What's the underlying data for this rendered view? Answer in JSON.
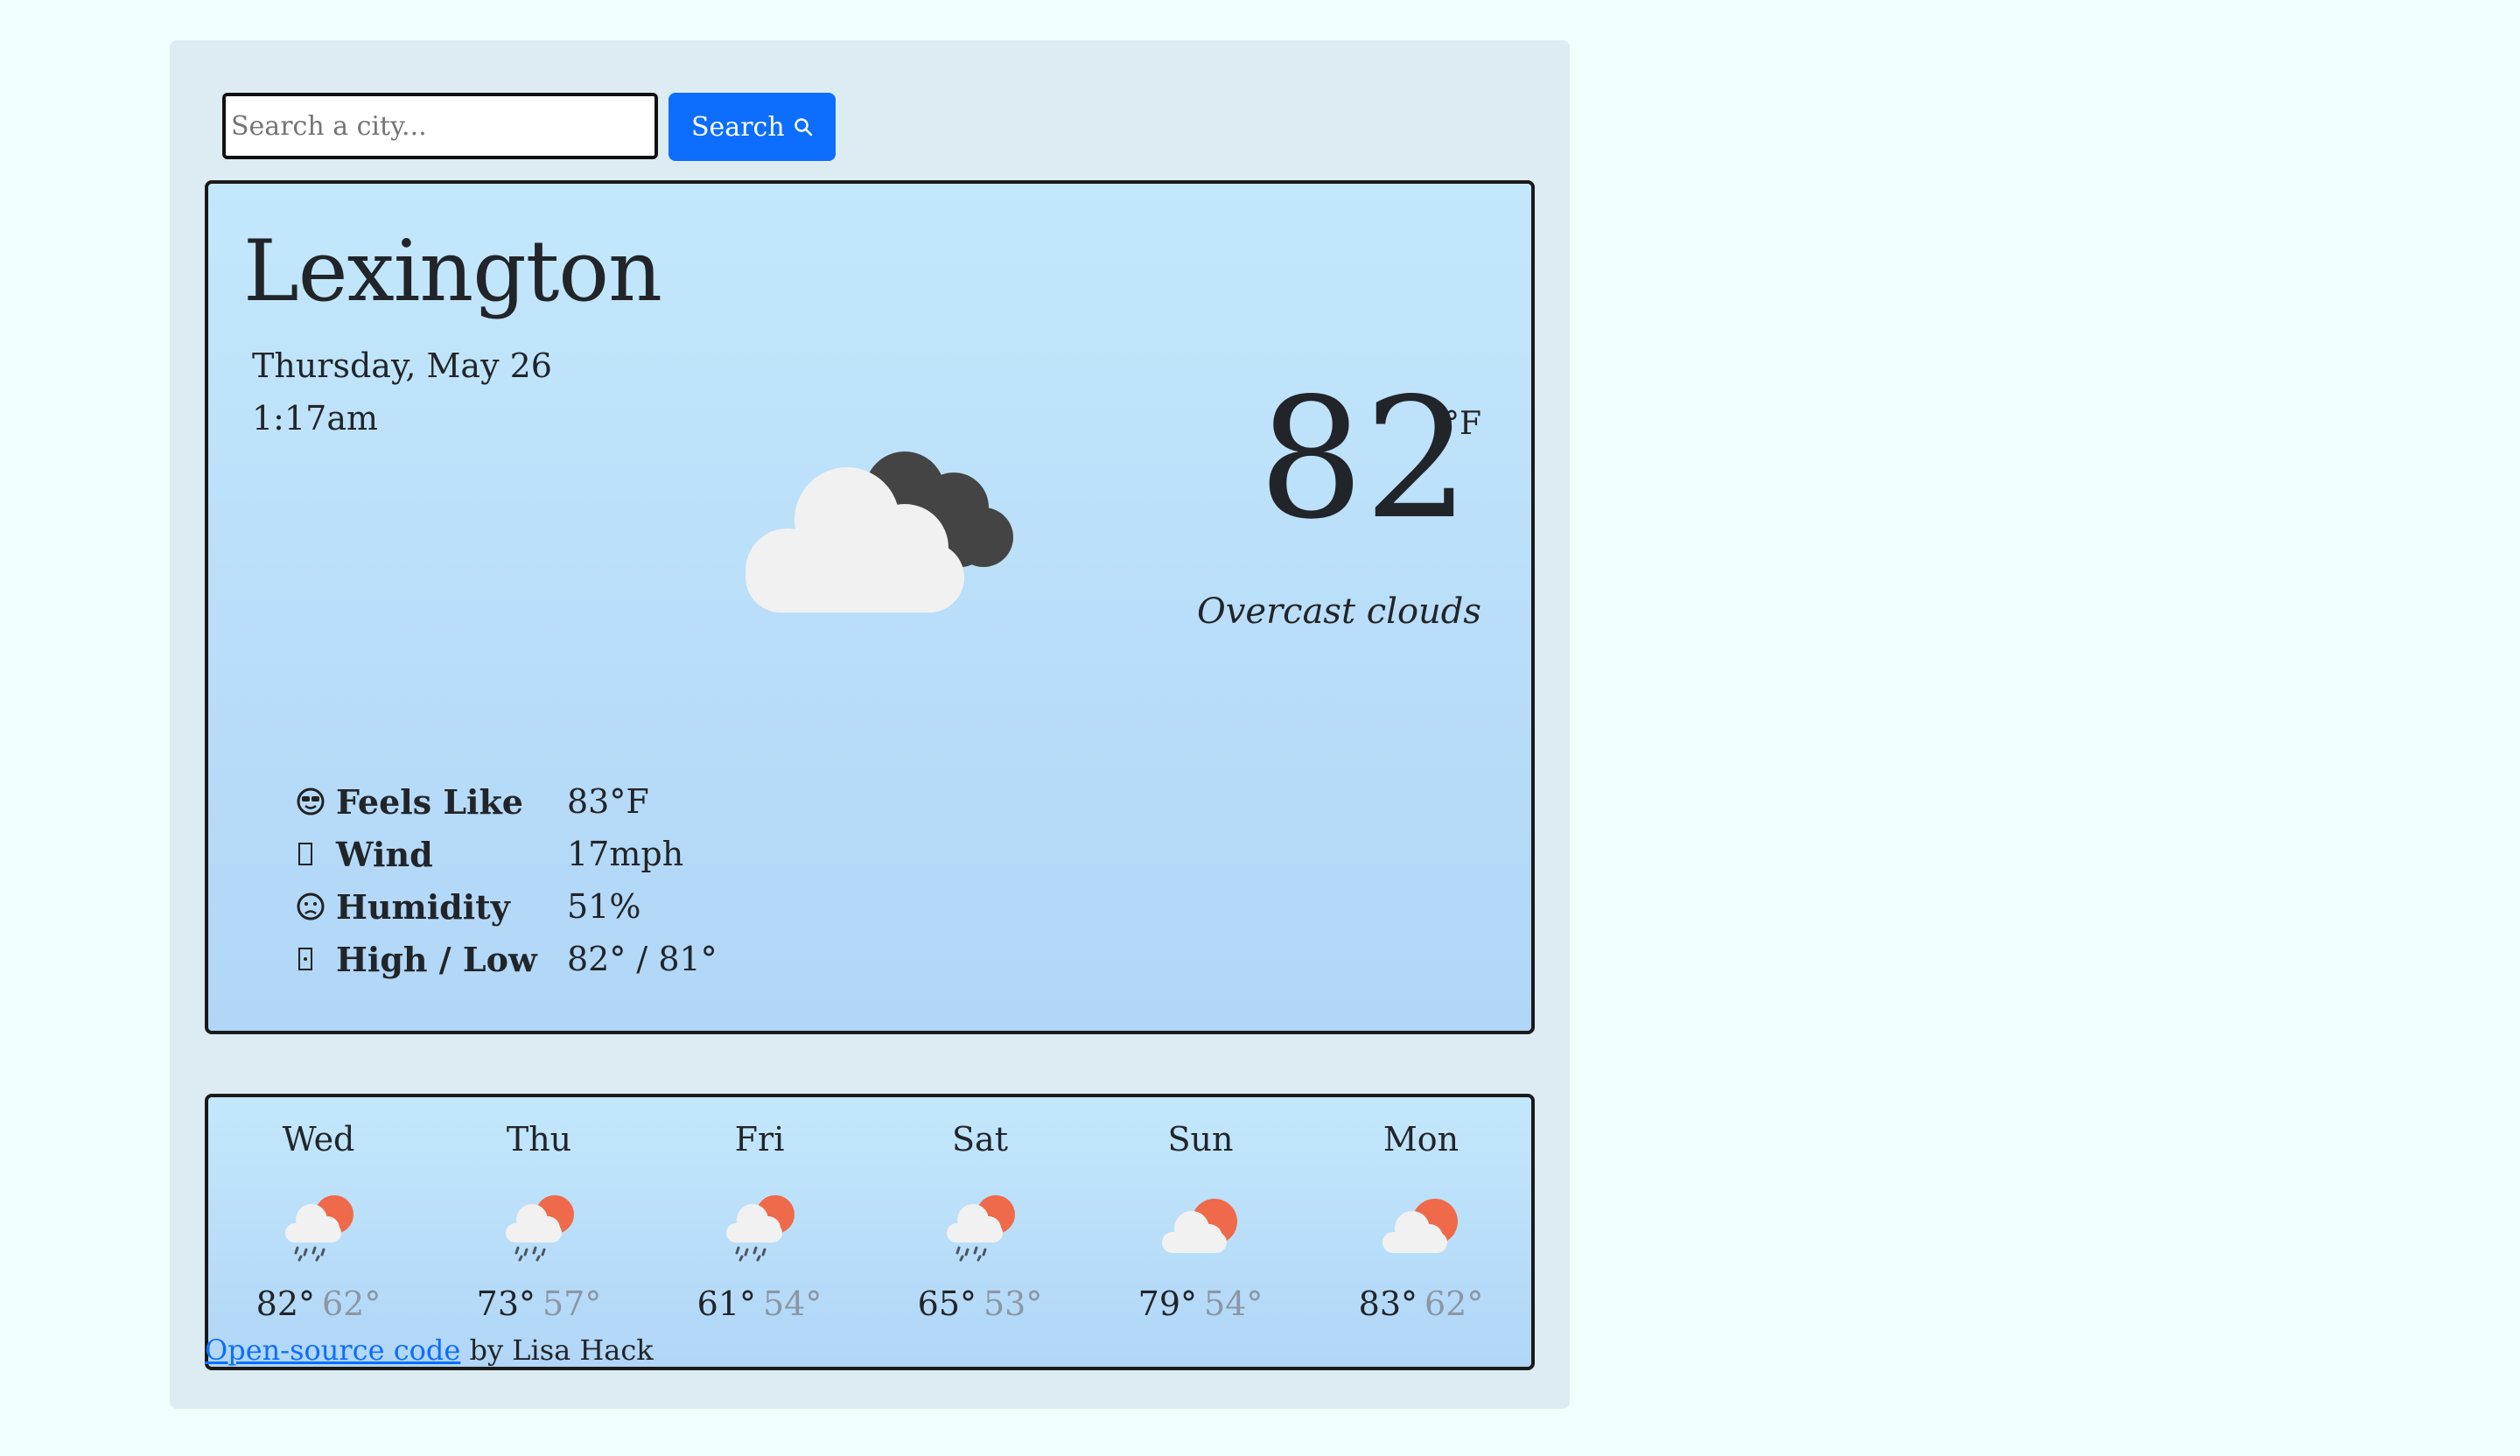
{
  "search": {
    "placeholder": "Search a city...",
    "button_label": "Search"
  },
  "current": {
    "city": "Lexington",
    "date": "Thursday, May 26",
    "time": "1:17am",
    "temperature": "82",
    "unit": "°F",
    "description": "Overcast clouds",
    "icon": "overcast-clouds-icon",
    "details": [
      {
        "icon": "sunglasses-face-icon",
        "label": "Feels Like",
        "value": "83°F"
      },
      {
        "icon": "wind-icon",
        "label": "Wind",
        "value": "17mph"
      },
      {
        "icon": "sweat-face-icon",
        "label": "Humidity",
        "value": "51%"
      },
      {
        "icon": "thermometer-icon",
        "label": "High / Low",
        "value": "82° / 81°"
      }
    ]
  },
  "forecast": [
    {
      "day": "Wed",
      "high": "82°",
      "low": "62°",
      "icon": "rain-sun-icon"
    },
    {
      "day": "Thu",
      "high": "73°",
      "low": "57°",
      "icon": "rain-sun-icon"
    },
    {
      "day": "Fri",
      "high": "61°",
      "low": "54°",
      "icon": "rain-sun-icon"
    },
    {
      "day": "Sat",
      "high": "65°",
      "low": "53°",
      "icon": "rain-sun-icon"
    },
    {
      "day": "Sun",
      "high": "79°",
      "low": "54°",
      "icon": "cloud-sun-icon"
    },
    {
      "day": "Mon",
      "high": "83°",
      "low": "62°",
      "icon": "cloud-sun-icon"
    }
  ],
  "footer": {
    "link_text": "Open-source code",
    "suffix": " by Lisa Hack"
  },
  "colors": {
    "accent": "#0d6efd",
    "page_background": "#f0feff",
    "card_background": "#ddebf3",
    "sun": "#ee6a4a",
    "cloud": "#f1f1f1",
    "dark_cloud": "#444444"
  }
}
